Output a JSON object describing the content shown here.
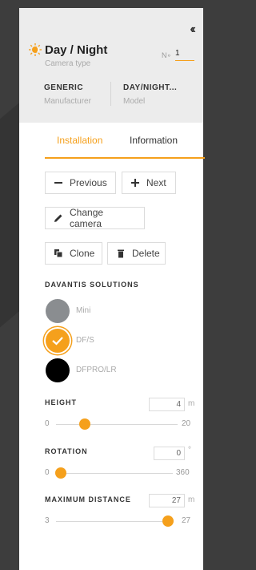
{
  "header": {
    "camera_name": "Day / Night",
    "camera_type_label": "Camera type",
    "number_label": "N∘",
    "number_value": "1",
    "manufacturer_value": "GENERIC",
    "manufacturer_label": "Manufacturer",
    "model_value": "DAY/NIGHT...",
    "model_label": "Model"
  },
  "tabs": [
    {
      "label": "Installation",
      "active": true
    },
    {
      "label": "Information",
      "active": false
    }
  ],
  "actions": {
    "previous": "Previous",
    "next": "Next",
    "change_camera": "Change camera",
    "clone": "Clone",
    "delete": "Delete"
  },
  "solutions": {
    "title": "DAVANTIS SOLUTIONS",
    "options": [
      {
        "label": "Mini",
        "color": "#8a8d90",
        "selected": false
      },
      {
        "label": "DF/S",
        "color": "#f5a01c",
        "selected": true
      },
      {
        "label": "DFPRO/LR",
        "color": "#000000",
        "selected": false
      }
    ]
  },
  "height": {
    "title": "HEIGHT",
    "value": "4",
    "unit": "m",
    "min": "0",
    "max": "20",
    "level": 0.2
  },
  "rotation": {
    "title": "ROTATION",
    "value": "0",
    "unit": "°",
    "min": "0",
    "max": "360",
    "level": 0
  },
  "max_distance": {
    "title": "MAXIMUM DISTANCE",
    "value": "27",
    "unit": "m",
    "min": "3",
    "max": "27",
    "level": 1
  },
  "colors": {
    "accent": "#f5a01c",
    "header_bg": "#ececec",
    "page_bg": "#3d3d3d"
  }
}
